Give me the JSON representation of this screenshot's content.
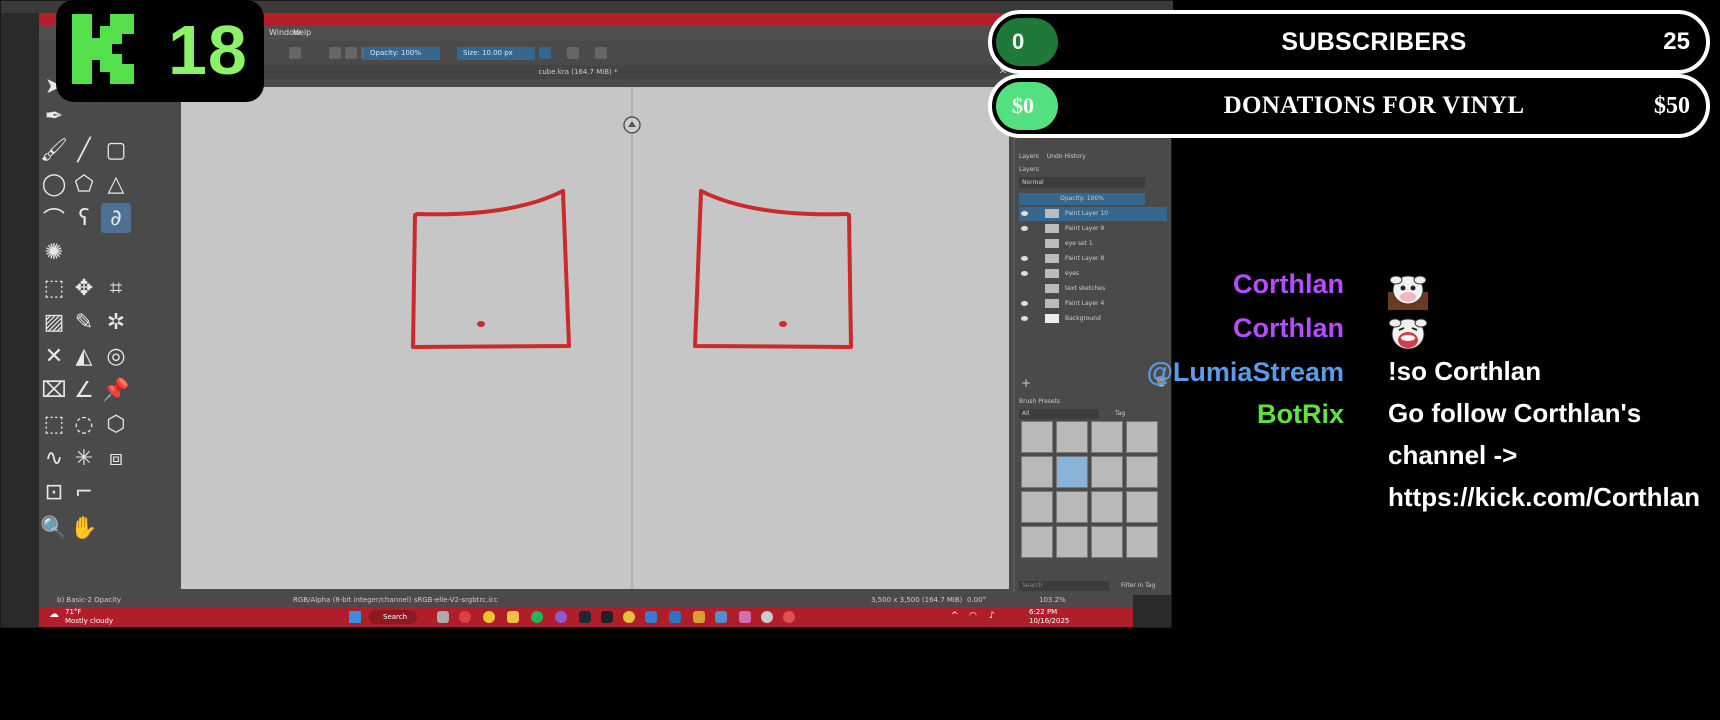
{
  "overlay": {
    "viewer_count": "18",
    "logo_letter": "K",
    "goals": {
      "subscribers": {
        "current": "0",
        "label": "SUBSCRIBERS",
        "target": "25",
        "progress": 0,
        "fill_color": "#1f7a3a"
      },
      "donations": {
        "current": "$0",
        "label": "DONATIONS FOR VINYL",
        "target": "$50",
        "progress": 0,
        "fill_color": "#53e07f"
      }
    },
    "accent": "#8cf26a"
  },
  "chat": [
    {
      "user": "Corthlan",
      "user_color": "#b44cff",
      "emote": "cow-emote",
      "text": ""
    },
    {
      "user": "Corthlan",
      "user_color": "#b44cff",
      "emote": "cow-laugh-emote",
      "text": ""
    },
    {
      "user": "@LumiaStream",
      "user_color": "#5b9be8",
      "text": "!so Corthlan"
    },
    {
      "user": "BotRix",
      "user_color": "#62e03f",
      "text": "Go follow Corthlan's channel -> https://kick.com/Corthlan"
    }
  ],
  "app": {
    "menu": [
      "Window",
      "Help"
    ],
    "toolbar": {
      "opacity": "Opacity: 100%",
      "size": "Size: 10.00 px"
    },
    "doc_title": "cube.kra (164.7 MiB) *",
    "layers_tabs": [
      "Layers",
      "Undo History"
    ],
    "blend_mode": "Normal",
    "layer_opacity": "Opacity: 100%",
    "layers": [
      "Paint Layer 10",
      "Paint Layer 9",
      "eye set 1",
      "Paint Layer 8",
      "eyes",
      "text sketches",
      "Paint Layer 4",
      "Background"
    ],
    "brush_presets_title": "Brush Presets",
    "brush_filter": "All",
    "brush_tag": "Tag",
    "search_placeholder": "Search",
    "filter_in_tag": "Filter in Tag",
    "status_left": "b) Basic-2 Opacity",
    "status_mid": "RGB/Alpha (8-bit integer/channel)  sRGB-elle-V2-srgbtrc.icc",
    "status_right": "3,500 x 3,500 (164.7 MiB)",
    "rotation": "0.00°",
    "zoom": "103.2%"
  },
  "taskbar": {
    "weather_temp": "71°F",
    "weather_desc": "Mostly cloudy",
    "search": "Search",
    "time": "6:22 PM",
    "date": "10/16/2025"
  }
}
